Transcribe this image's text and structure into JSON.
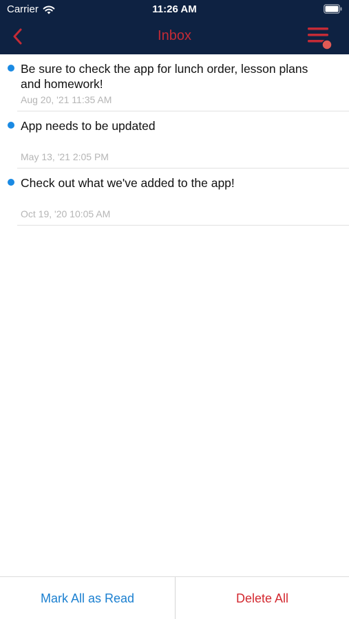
{
  "status_bar": {
    "carrier": "Carrier",
    "time": "11:26 AM",
    "wifi_icon": "wifi-icon",
    "battery_icon": "battery-full-icon"
  },
  "nav": {
    "title": "Inbox",
    "back_icon": "chevron-left-icon",
    "menu_icon": "hamburger-menu-icon",
    "menu_has_notification_badge": true
  },
  "messages": [
    {
      "text": "Be sure to check the app for lunch order, lesson plans and homework!",
      "date": "Aug 20, '21 11:35 AM",
      "unread": true
    },
    {
      "text": "App needs to be updated",
      "date": "May 13, '21 2:05 PM",
      "unread": true
    },
    {
      "text": "Check out what we've added to the app!",
      "date": "Oct 19, '20 10:05 AM",
      "unread": true
    }
  ],
  "actions": {
    "mark_all_read": "Mark All as Read",
    "delete_all": "Delete All"
  },
  "colors": {
    "header_background": "#0e2242",
    "accent_red": "#c42b36",
    "unread_dot": "#1a8ae3",
    "link_blue": "#1a7fd0",
    "delete_red": "#d3282f",
    "badge_red": "#e25a55"
  }
}
